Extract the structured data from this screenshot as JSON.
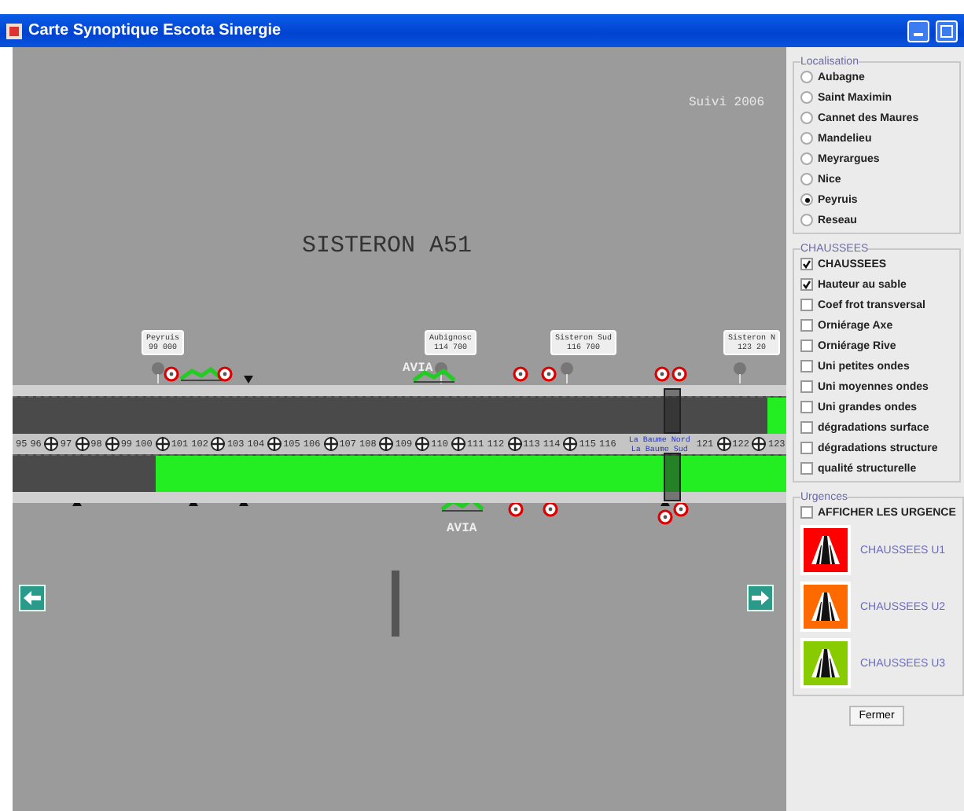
{
  "window": {
    "title": "Carte Synoptique Escota Sinergie"
  },
  "map": {
    "caption": "Suivi 2006",
    "section_title": "SISTERON A51",
    "signs": [
      {
        "name": "Peyruis",
        "km": "99 000"
      },
      {
        "name": "Aubignosc",
        "km": "114 700"
      },
      {
        "name": "Sisteron Sud",
        "km": "116 700"
      },
      {
        "name": "Sisteron N",
        "km": "123 20"
      }
    ],
    "service_areas": [
      {
        "label": "AVIA"
      },
      {
        "label": "AVIA"
      }
    ],
    "interchange": {
      "north": "La Baume Nord",
      "south": "La Baume Sud"
    },
    "upper_surveyed": {
      "level": 0.025
    },
    "lower_surveyed": {
      "level": 0.815
    },
    "km_markers": [
      {
        "label": "95",
        "marker": false
      },
      {
        "label": "96",
        "marker": false
      },
      {
        "label": "97",
        "marker": true
      },
      {
        "label": "98",
        "marker": true
      },
      {
        "label": "99",
        "marker": true
      },
      {
        "label": "100",
        "marker": false
      },
      {
        "label": "101",
        "marker": true
      },
      {
        "label": "102",
        "marker": false
      },
      {
        "label": "103",
        "marker": true
      },
      {
        "label": "104",
        "marker": false
      },
      {
        "label": "105",
        "marker": true
      },
      {
        "label": "106",
        "marker": false
      },
      {
        "label": "107",
        "marker": true
      },
      {
        "label": "108",
        "marker": false
      },
      {
        "label": "109",
        "marker": true
      },
      {
        "label": "110",
        "marker": true
      },
      {
        "label": "111",
        "marker": true
      },
      {
        "label": "112",
        "marker": false
      },
      {
        "label": "113",
        "marker": true
      },
      {
        "label": "114",
        "marker": false
      },
      {
        "label": "115",
        "marker": true
      },
      {
        "label": "116",
        "marker": false
      }
    ],
    "right_km_markers": [
      {
        "label": "121",
        "marker": false
      },
      {
        "label": "122",
        "marker": true
      },
      {
        "label": "123",
        "marker": true
      }
    ]
  },
  "panel": {
    "localisation": {
      "title": "Localisation",
      "options": [
        {
          "label": "Aubagne",
          "selected": false
        },
        {
          "label": "Saint Maximin",
          "selected": false
        },
        {
          "label": "Cannet des Maures",
          "selected": false
        },
        {
          "label": "Mandelieu",
          "selected": false
        },
        {
          "label": "Meyrargues",
          "selected": false
        },
        {
          "label": "Nice",
          "selected": false
        },
        {
          "label": "Peyruis",
          "selected": true
        },
        {
          "label": "Reseau",
          "selected": false
        }
      ]
    },
    "chaussees": {
      "title": "CHAUSSEES",
      "options": [
        {
          "label": "CHAUSSEES",
          "checked": true
        },
        {
          "label": "Hauteur au sable",
          "checked": true
        },
        {
          "label": "Coef frot transversal",
          "checked": false
        },
        {
          "label": "Orniérage Axe",
          "checked": false
        },
        {
          "label": "Orniérage Rive",
          "checked": false
        },
        {
          "label": "Uni petites ondes",
          "checked": false
        },
        {
          "label": "Uni moyennes ondes",
          "checked": false
        },
        {
          "label": "Uni grandes ondes",
          "checked": false
        },
        {
          "label": "dégradations surface",
          "checked": false
        },
        {
          "label": "dégradations structure",
          "checked": false
        },
        {
          "label": "qualité structurelle",
          "checked": false
        }
      ]
    },
    "urgences": {
      "title": "Urgences",
      "toggle": {
        "label": "AFFICHER LES URGENCE",
        "checked": false
      },
      "levels": [
        {
          "label": "CHAUSSEES U1",
          "color": "#ff0000"
        },
        {
          "label": "CHAUSSEES U2",
          "color": "#ff6a00"
        },
        {
          "label": "CHAUSSEES U3",
          "color": "#88cc00"
        }
      ]
    },
    "close_button": "Fermer"
  }
}
